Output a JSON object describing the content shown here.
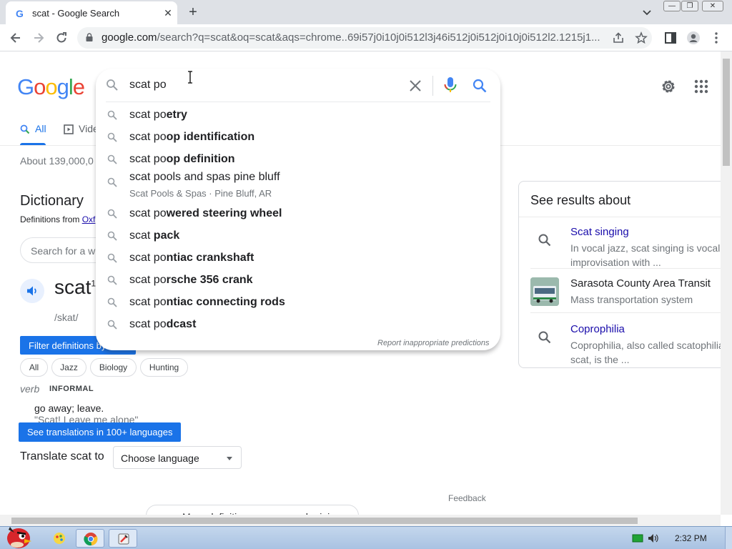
{
  "browser": {
    "tab_title": "scat - Google Search",
    "url_host": "google.com",
    "url_rest": "/search?q=scat&oq=scat&aqs=chrome..69i57j0i10j0i512l3j46i512j0i512j0i10j0i512l2.1215j1..."
  },
  "google": {
    "logo": "Google",
    "tabs": [
      {
        "label": "All"
      },
      {
        "label": "Vide"
      }
    ],
    "result_stats": "About 139,000,0"
  },
  "search": {
    "query": "scat po",
    "suggestions": [
      {
        "typed": "scat po",
        "completion": "etry",
        "sub": ""
      },
      {
        "typed": "scat po",
        "completion": "op identification",
        "sub": ""
      },
      {
        "typed": "scat po",
        "completion": "op definition",
        "sub": ""
      },
      {
        "typed": "scat pools and spas pine bluff",
        "completion": "",
        "sub": "Scat Pools & Spas · Pine Bluff, AR"
      },
      {
        "typed": "scat po",
        "completion": "wered steering wheel",
        "sub": ""
      },
      {
        "typed": "scat ",
        "completion": "pack",
        "sub": ""
      },
      {
        "typed": "scat po",
        "completion": "ntiac crankshaft",
        "sub": ""
      },
      {
        "typed": "scat po",
        "completion": "rsche 356 crank",
        "sub": ""
      },
      {
        "typed": "scat po",
        "completion": "ntiac connecting rods",
        "sub": ""
      },
      {
        "typed": "scat po",
        "completion": "dcast",
        "sub": ""
      }
    ],
    "report_link": "Report inappropriate predictions"
  },
  "dictionary": {
    "title": "Dictionary",
    "from_prefix": "Definitions from ",
    "from_source": "Oxf",
    "search_placeholder": "Search for a w",
    "word": "scat",
    "word_sup": "1",
    "phonetic": "/skat/",
    "filter_label": "Filter definitions by to",
    "chips": [
      "All",
      "Jazz",
      "Biology",
      "Hunting"
    ],
    "pos": "verb",
    "register": "INFORMAL",
    "definition": "go away; leave.",
    "example": "\"Scat! Leave me alone\"",
    "translations_tip": "See translations in 100+ languages",
    "translate_label": "Translate scat to",
    "language_select": "Choose language",
    "feedback": "Feedback",
    "more_definitions": "More definitions, usage, and origin"
  },
  "side_panel": {
    "title": "See results about",
    "items": [
      {
        "title": "Scat singing",
        "desc": "In vocal jazz, scat singing is vocal improvisation with ..."
      },
      {
        "title": "Sarasota County Area Transit",
        "desc": "Mass transportation system"
      },
      {
        "title": "Coprophilia",
        "desc": "Coprophilia, also called scatophilia scat, is the ..."
      }
    ]
  },
  "taskbar": {
    "time": "2:32 PM"
  },
  "colors": {
    "google_blue": "#4285f4",
    "google_red": "#ea4335",
    "google_yellow": "#fbbc05",
    "google_green": "#34a853",
    "link": "#1a0dab",
    "accent": "#1a73e8"
  },
  "icons": {
    "search": "search-icon",
    "clear": "close-icon",
    "mic": "mic-icon",
    "settings": "gear-icon",
    "apps": "apps-grid-icon"
  }
}
